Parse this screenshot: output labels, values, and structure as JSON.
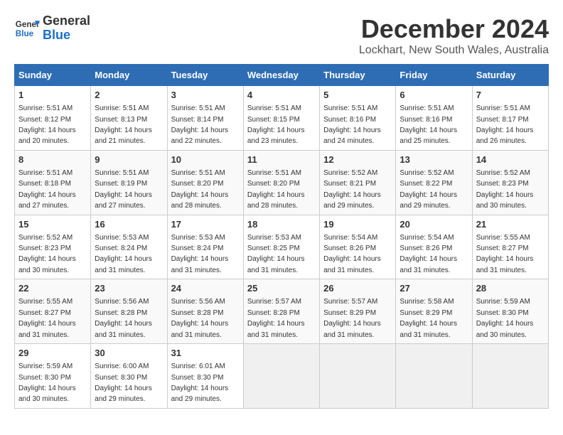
{
  "header": {
    "logo_line1": "General",
    "logo_line2": "Blue",
    "month_title": "December 2024",
    "location": "Lockhart, New South Wales, Australia"
  },
  "weekdays": [
    "Sunday",
    "Monday",
    "Tuesday",
    "Wednesday",
    "Thursday",
    "Friday",
    "Saturday"
  ],
  "weeks": [
    [
      {
        "day": "1",
        "sunrise": "5:51 AM",
        "sunset": "8:12 PM",
        "daylight": "14 hours and 20 minutes."
      },
      {
        "day": "2",
        "sunrise": "5:51 AM",
        "sunset": "8:13 PM",
        "daylight": "14 hours and 21 minutes."
      },
      {
        "day": "3",
        "sunrise": "5:51 AM",
        "sunset": "8:14 PM",
        "daylight": "14 hours and 22 minutes."
      },
      {
        "day": "4",
        "sunrise": "5:51 AM",
        "sunset": "8:15 PM",
        "daylight": "14 hours and 23 minutes."
      },
      {
        "day": "5",
        "sunrise": "5:51 AM",
        "sunset": "8:16 PM",
        "daylight": "14 hours and 24 minutes."
      },
      {
        "day": "6",
        "sunrise": "5:51 AM",
        "sunset": "8:16 PM",
        "daylight": "14 hours and 25 minutes."
      },
      {
        "day": "7",
        "sunrise": "5:51 AM",
        "sunset": "8:17 PM",
        "daylight": "14 hours and 26 minutes."
      }
    ],
    [
      {
        "day": "8",
        "sunrise": "5:51 AM",
        "sunset": "8:18 PM",
        "daylight": "14 hours and 27 minutes."
      },
      {
        "day": "9",
        "sunrise": "5:51 AM",
        "sunset": "8:19 PM",
        "daylight": "14 hours and 27 minutes."
      },
      {
        "day": "10",
        "sunrise": "5:51 AM",
        "sunset": "8:20 PM",
        "daylight": "14 hours and 28 minutes."
      },
      {
        "day": "11",
        "sunrise": "5:51 AM",
        "sunset": "8:20 PM",
        "daylight": "14 hours and 28 minutes."
      },
      {
        "day": "12",
        "sunrise": "5:52 AM",
        "sunset": "8:21 PM",
        "daylight": "14 hours and 29 minutes."
      },
      {
        "day": "13",
        "sunrise": "5:52 AM",
        "sunset": "8:22 PM",
        "daylight": "14 hours and 29 minutes."
      },
      {
        "day": "14",
        "sunrise": "5:52 AM",
        "sunset": "8:23 PM",
        "daylight": "14 hours and 30 minutes."
      }
    ],
    [
      {
        "day": "15",
        "sunrise": "5:52 AM",
        "sunset": "8:23 PM",
        "daylight": "14 hours and 30 minutes."
      },
      {
        "day": "16",
        "sunrise": "5:53 AM",
        "sunset": "8:24 PM",
        "daylight": "14 hours and 31 minutes."
      },
      {
        "day": "17",
        "sunrise": "5:53 AM",
        "sunset": "8:24 PM",
        "daylight": "14 hours and 31 minutes."
      },
      {
        "day": "18",
        "sunrise": "5:53 AM",
        "sunset": "8:25 PM",
        "daylight": "14 hours and 31 minutes."
      },
      {
        "day": "19",
        "sunrise": "5:54 AM",
        "sunset": "8:26 PM",
        "daylight": "14 hours and 31 minutes."
      },
      {
        "day": "20",
        "sunrise": "5:54 AM",
        "sunset": "8:26 PM",
        "daylight": "14 hours and 31 minutes."
      },
      {
        "day": "21",
        "sunrise": "5:55 AM",
        "sunset": "8:27 PM",
        "daylight": "14 hours and 31 minutes."
      }
    ],
    [
      {
        "day": "22",
        "sunrise": "5:55 AM",
        "sunset": "8:27 PM",
        "daylight": "14 hours and 31 minutes."
      },
      {
        "day": "23",
        "sunrise": "5:56 AM",
        "sunset": "8:28 PM",
        "daylight": "14 hours and 31 minutes."
      },
      {
        "day": "24",
        "sunrise": "5:56 AM",
        "sunset": "8:28 PM",
        "daylight": "14 hours and 31 minutes."
      },
      {
        "day": "25",
        "sunrise": "5:57 AM",
        "sunset": "8:28 PM",
        "daylight": "14 hours and 31 minutes."
      },
      {
        "day": "26",
        "sunrise": "5:57 AM",
        "sunset": "8:29 PM",
        "daylight": "14 hours and 31 minutes."
      },
      {
        "day": "27",
        "sunrise": "5:58 AM",
        "sunset": "8:29 PM",
        "daylight": "14 hours and 31 minutes."
      },
      {
        "day": "28",
        "sunrise": "5:59 AM",
        "sunset": "8:30 PM",
        "daylight": "14 hours and 30 minutes."
      }
    ],
    [
      {
        "day": "29",
        "sunrise": "5:59 AM",
        "sunset": "8:30 PM",
        "daylight": "14 hours and 30 minutes."
      },
      {
        "day": "30",
        "sunrise": "6:00 AM",
        "sunset": "8:30 PM",
        "daylight": "14 hours and 29 minutes."
      },
      {
        "day": "31",
        "sunrise": "6:01 AM",
        "sunset": "8:30 PM",
        "daylight": "14 hours and 29 minutes."
      },
      null,
      null,
      null,
      null
    ]
  ]
}
